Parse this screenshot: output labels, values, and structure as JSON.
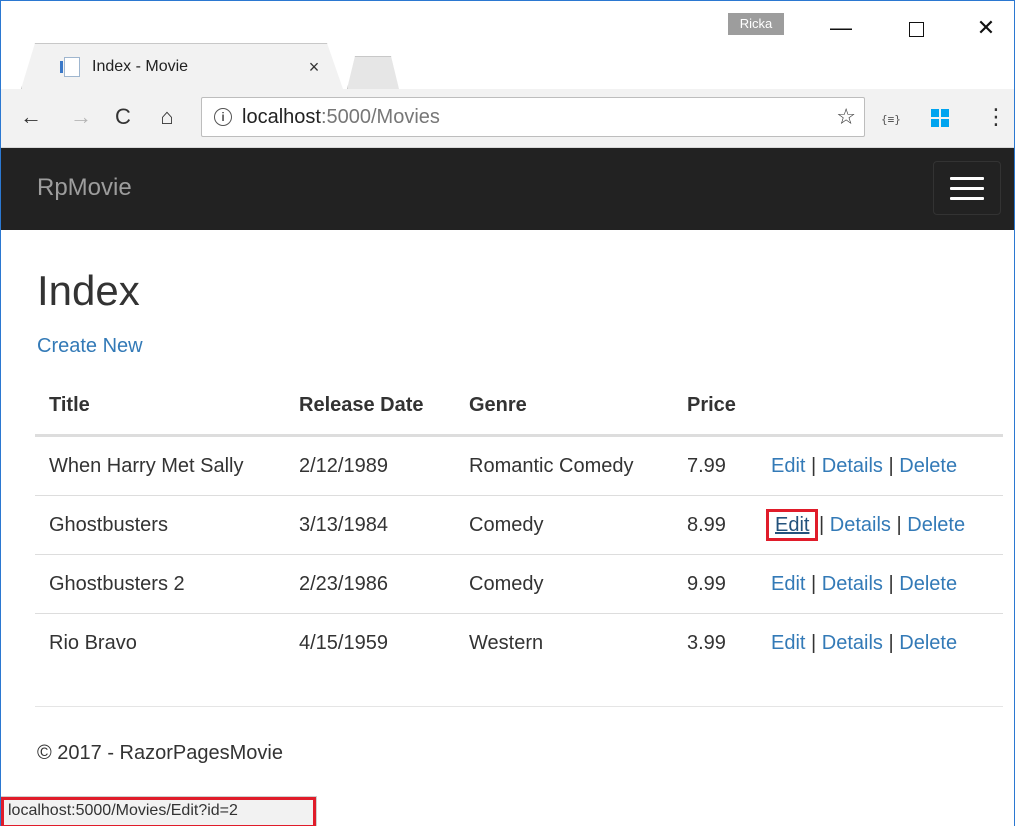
{
  "browser": {
    "tab_title": "Index - Movie",
    "tab_close_glyph": "×",
    "profile_name": "Ricka",
    "url_host": "localhost",
    "url_path": ":5000/Movies",
    "status_url": "localhost:5000/Movies/Edit?id=2",
    "accent_color": "#2b78d1"
  },
  "navbar": {
    "brand": "RpMovie",
    "background": "#222222"
  },
  "page": {
    "title": "Index",
    "create_link": "Create New",
    "footer": "© 2017 - RazorPagesMovie"
  },
  "table": {
    "headers": {
      "title": "Title",
      "release_date": "Release Date",
      "genre": "Genre",
      "price": "Price"
    },
    "action_labels": {
      "edit": "Edit",
      "details": "Details",
      "delete": "Delete",
      "separator": "|"
    },
    "rows": [
      {
        "title": "When Harry Met Sally",
        "release_date": "2/12/1989",
        "genre": "Romantic Comedy",
        "price": "7.99"
      },
      {
        "title": "Ghostbusters",
        "release_date": "3/13/1984",
        "genre": "Comedy",
        "price": "8.99"
      },
      {
        "title": "Ghostbusters 2",
        "release_date": "2/23/1986",
        "genre": "Comedy",
        "price": "9.99"
      },
      {
        "title": "Rio Bravo",
        "release_date": "4/15/1959",
        "genre": "Western",
        "price": "3.99"
      }
    ]
  },
  "highlight_color": "#e01c2a"
}
